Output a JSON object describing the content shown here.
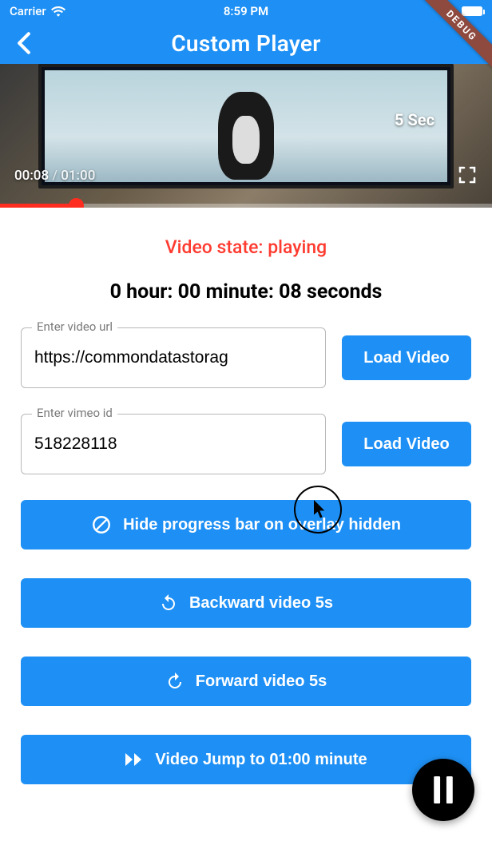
{
  "statusbar": {
    "carrier": "Carrier",
    "time": "8:59 PM"
  },
  "nav": {
    "title": "Custom Player"
  },
  "debug_label": "DEBUG",
  "video": {
    "current": "00:08",
    "duration": "01:00",
    "skip_label": "5 Sec",
    "progress_percent": 14
  },
  "state_label": "Video state: playing",
  "time_display": "0 hour: 00 minute: 08 seconds",
  "url_field": {
    "legend": "Enter video url",
    "value": "https://commondatastorag"
  },
  "vimeo_field": {
    "legend": "Enter vimeo id",
    "value": "518228118"
  },
  "buttons": {
    "load_video": "Load Video",
    "hide_progress": "Hide progress bar on overlay hidden",
    "backward": "Backward video 5s",
    "forward": "Forward video 5s",
    "jump": "Video Jump to 01:00 minute"
  }
}
